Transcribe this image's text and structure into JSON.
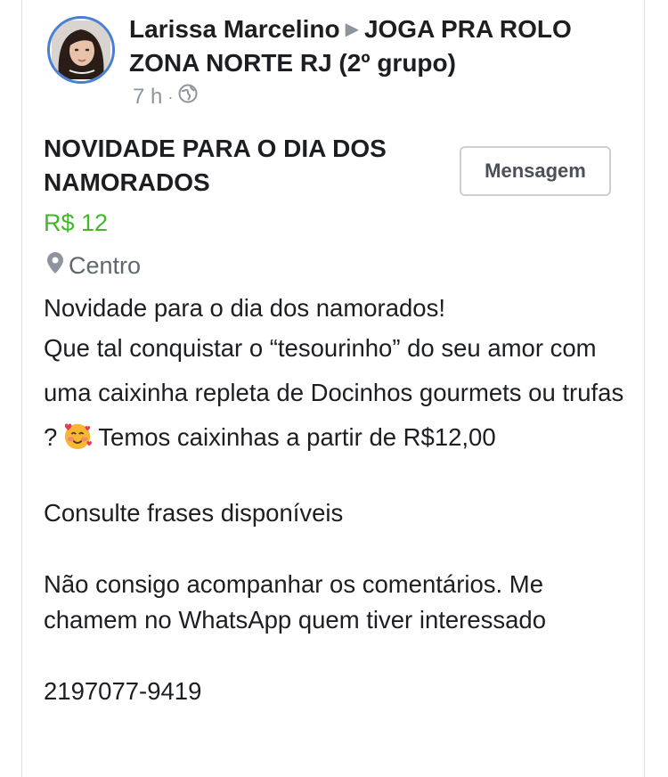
{
  "post": {
    "author": "Larissa Marcelino",
    "group": "JOGA PRA ROLO ZONA NORTE RJ (2º grupo)",
    "time": "7 h",
    "title": "NOVIDADE PARA O DIA DOS NAMORADOS",
    "message_button": "Mensagem",
    "price": "R$ 12",
    "location": "Centro",
    "body": {
      "line1": "Novidade para o dia dos namorados!",
      "line2": "Que tal conquistar o “tesourinho” do seu amor com uma caixinha repleta de Docinhos gourmets ou trufas ?",
      "line2_emoji": "smiling-face-with-hearts-icon",
      "line2b": "Temos caixinhas a partir de R$12,00",
      "line3": "Consulte frases disponíveis",
      "line4": "Não consigo acompanhar os comentários. Me chamem no WhatsApp quem tiver interessado",
      "phone": "2197077-9419"
    }
  },
  "colors": {
    "price": "#42b72a",
    "avatar_ring": "#4a7fd6",
    "meta": "#8d949e"
  }
}
